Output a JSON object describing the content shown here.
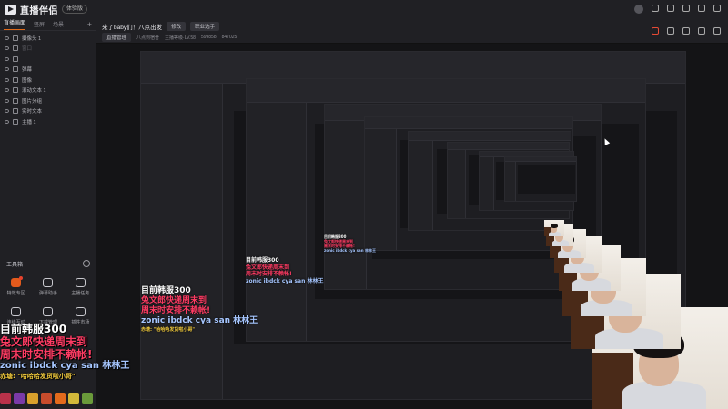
{
  "app": {
    "name": "直播伴侣",
    "edition": "体验版"
  },
  "scene_tabs": [
    {
      "label": "直播画面",
      "active": true
    },
    {
      "label": "竖屏"
    },
    {
      "label": "场景"
    }
  ],
  "sources": [
    {
      "label": "摄像头 1",
      "dim": false
    },
    {
      "label": "窗口",
      "dim": true
    },
    {
      "label": "",
      "dim": true
    },
    {
      "label": "弹幕",
      "dim": false
    },
    {
      "label": "图像",
      "dim": false
    },
    {
      "label": "滚动文本 1",
      "dim": false
    },
    {
      "label": "图片分组",
      "dim": false
    },
    {
      "label": "实时文本",
      "dim": false
    },
    {
      "label": "主播 1",
      "dim": false
    }
  ],
  "toolbox": {
    "title": "工具箱",
    "tools": [
      {
        "label": "特效专区",
        "hot": true,
        "badge": true
      },
      {
        "label": "弹幕助手"
      },
      {
        "label": "主播任务"
      },
      {
        "label": "连线互动"
      },
      {
        "label": "下载管理"
      },
      {
        "label": "插件市场"
      }
    ]
  },
  "topbar": {
    "title": "来了baby们！八点出发",
    "edit_chip": "修改",
    "category_chip": "职业选手",
    "meta_chip": "直播管理",
    "meta_chip2": "八点到宿舍",
    "meta_a": "主播等级·LV.58",
    "meta_viewers": "599858",
    "meta_likes": "847025"
  },
  "chat": {
    "line1": "目前韩服300",
    "line2": "兔文郎快递周末到",
    "line3": "周末时安排不赖帐!",
    "line4": "zonic ibdck cya san 林林王",
    "line5": "赤塘: \"哈哈哈发货啦小哥\""
  },
  "colors": {
    "accent": "#e35a1c",
    "chat_red": "#ff3c64",
    "chat_blue": "#a6c6ff"
  }
}
